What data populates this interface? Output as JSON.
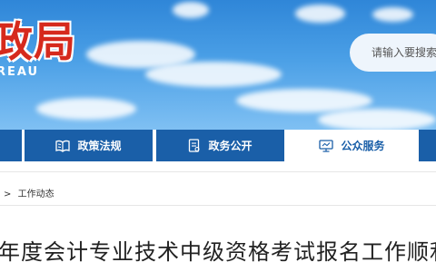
{
  "header": {
    "brand_name": "政局",
    "brand_sub": "REAU",
    "search_placeholder": "请输入要搜索"
  },
  "nav": {
    "items": [
      {
        "label": "政策法规",
        "icon": "book-icon"
      },
      {
        "label": "政务公开",
        "icon": "document-icon"
      },
      {
        "label": "公众服务",
        "icon": "monitor-icon",
        "active": true
      }
    ]
  },
  "breadcrumb": {
    "separator": ">",
    "current": "工作动态"
  },
  "article": {
    "title": "年度会计专业技术中级资格考试报名工作顺利"
  },
  "colors": {
    "nav_bg": "#1a5fa8",
    "brand_red": "#d62a1d",
    "sky": "#4a9fe6"
  }
}
